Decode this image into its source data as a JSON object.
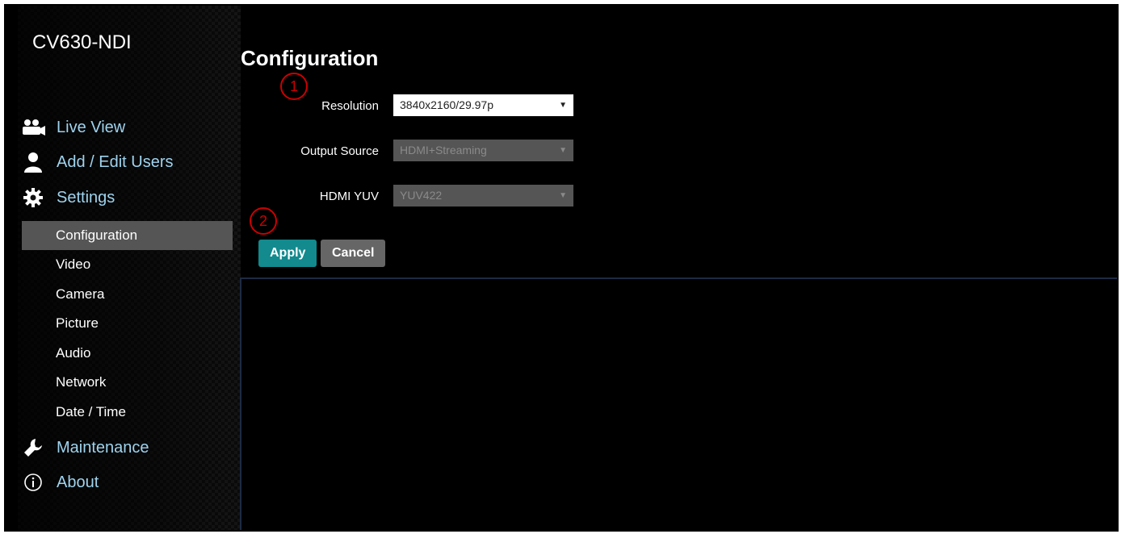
{
  "sidebar": {
    "brand": "CV630-NDI",
    "nav": [
      {
        "label": "Live View",
        "icon": "live-view-icon"
      },
      {
        "label": "Add / Edit Users",
        "icon": "user-icon"
      },
      {
        "label": "Settings",
        "icon": "gear-icon"
      }
    ],
    "settings_items": [
      "Configuration",
      "Video",
      "Camera",
      "Picture",
      "Audio",
      "Network",
      "Date / Time"
    ],
    "active_item": "Configuration",
    "footer_nav": [
      {
        "label": "Maintenance",
        "icon": "wrench-icon"
      },
      {
        "label": "About",
        "icon": "info-icon"
      }
    ]
  },
  "main": {
    "title": "Configuration",
    "fields": {
      "resolution": {
        "label": "Resolution",
        "value": "3840x2160/29.97p",
        "enabled": true
      },
      "output_source": {
        "label": "Output Source",
        "value": "HDMI+Streaming",
        "enabled": false
      },
      "hdmi_yuv": {
        "label": "HDMI YUV",
        "value": "YUV422",
        "enabled": false
      }
    },
    "markers": [
      "1",
      "2"
    ],
    "buttons": {
      "apply": "Apply",
      "cancel": "Cancel"
    }
  },
  "colors": {
    "accent": "#128a8e",
    "nav_text": "#9fd3ee",
    "marker": "#cc0000"
  }
}
